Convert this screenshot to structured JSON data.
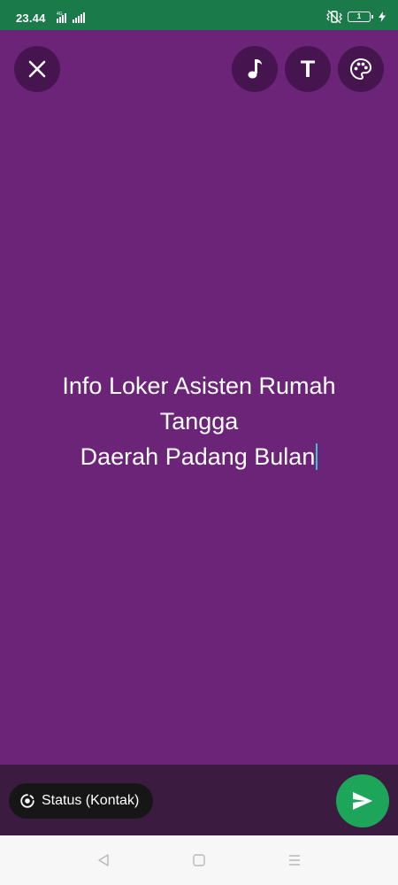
{
  "status_bar": {
    "time": "23.44",
    "battery_level": "1",
    "background_color": "#1a7a4a",
    "icons": [
      "signal-icon",
      "vibrate-icon",
      "battery-icon",
      "charging-icon"
    ]
  },
  "editor": {
    "background_color": "#6c2479",
    "toolbar": {
      "close_icon": "close-icon",
      "music_icon": "music-note-icon",
      "text_icon_label": "T",
      "palette_icon": "palette-icon"
    },
    "text_lines": [
      "Info Loker Asisten Rumah",
      "Tangga",
      "Daerah Padang Bulan"
    ],
    "caret_color": "#3ac4c9"
  },
  "bottom": {
    "audience_label": "Status (Kontak)",
    "audience_icon": "status-ring-icon",
    "send_icon": "send-icon",
    "send_color": "#1da55a"
  },
  "nav": {
    "icons": [
      "back-icon",
      "home-icon",
      "menu-icon"
    ]
  }
}
